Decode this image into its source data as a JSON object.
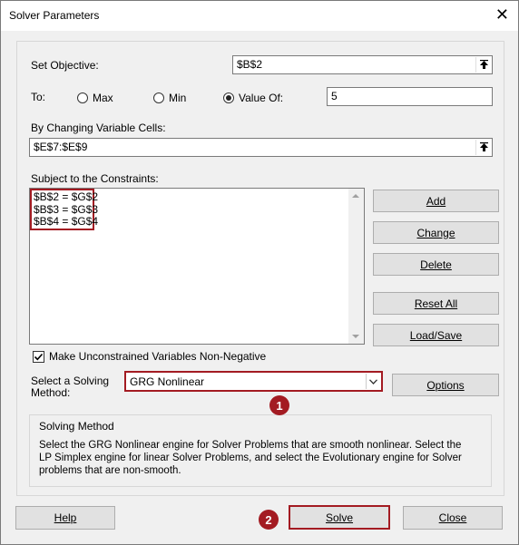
{
  "window": {
    "title": "Solver Parameters",
    "close_glyph": "✕"
  },
  "objective": {
    "label": "Set Objective:",
    "value": "$B$2"
  },
  "to": {
    "label": "To:",
    "options": [
      {
        "label": "Max",
        "selected": false
      },
      {
        "label": "Min",
        "selected": false
      },
      {
        "label": "Value Of:",
        "selected": true
      }
    ],
    "value_of": "5"
  },
  "changing_cells": {
    "label": "By Changing Variable Cells:",
    "value": "$E$7:$E$9"
  },
  "constraints": {
    "label": "Subject to the Constraints:",
    "items": [
      "$B$2 = $G$2",
      "$B$3 = $G$3",
      "$B$4 = $G$4"
    ]
  },
  "side_buttons": {
    "add": "Add",
    "change": "Change",
    "delete": "Delete",
    "reset_all": "Reset All",
    "load_save": "Load/Save"
  },
  "nonnegative": {
    "label": "Make Unconstrained Variables Non-Negative",
    "checked": true
  },
  "method": {
    "label_line1": "Select a Solving",
    "label_line2": "Method:",
    "value": "GRG Nonlinear",
    "options_button": "Options"
  },
  "solving_method": {
    "title": "Solving Method",
    "description": "Select the GRG Nonlinear engine for Solver Problems that are smooth nonlinear. Select the LP Simplex engine for linear Solver Problems, and select the Evolutionary engine for Solver problems that are non-smooth."
  },
  "footer": {
    "help": "Help",
    "solve": "Solve",
    "close": "Close"
  },
  "annotations": {
    "badge1": "1",
    "badge2": "2"
  },
  "colors": {
    "highlight": "#a31b22",
    "button_face": "#e1e1e1",
    "dialog_bg": "#f0f0f0"
  }
}
